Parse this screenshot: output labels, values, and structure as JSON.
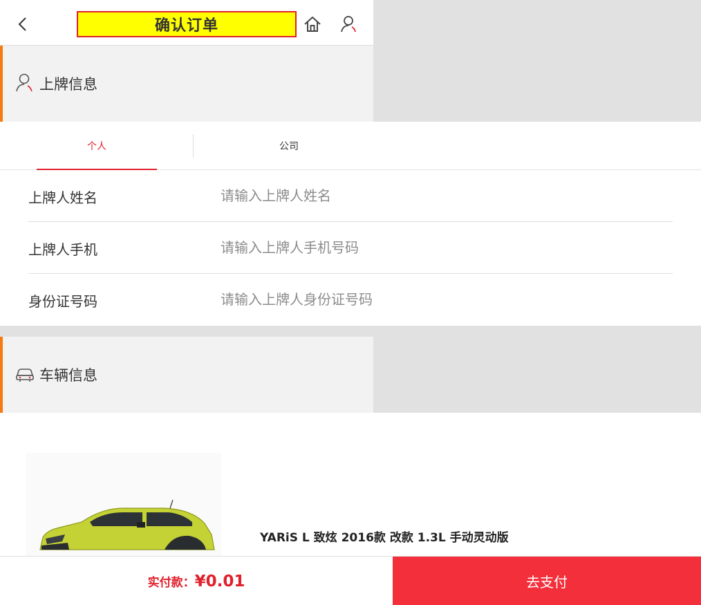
{
  "header": {
    "title": "确认订单",
    "back_icon": "chevron-left",
    "home_icon": "home",
    "user_icon": "user"
  },
  "plate_section": {
    "title": "上牌信息",
    "icon": "user-icon",
    "tabs": [
      {
        "label": "个人",
        "active": true
      },
      {
        "label": "公司",
        "active": false
      }
    ],
    "fields": [
      {
        "label": "上牌人姓名",
        "placeholder": "请输入上牌人姓名",
        "value": ""
      },
      {
        "label": "上牌人手机",
        "placeholder": "请输入上牌人手机号码",
        "value": ""
      },
      {
        "label": "身份证号码",
        "placeholder": "请输入上牌人身份证号码",
        "value": ""
      }
    ]
  },
  "vehicle_section": {
    "title": "车辆信息",
    "icon": "car-icon",
    "car_name": "YARiS L 致炫 2016款 改款 1.3L 手动灵动版"
  },
  "bottom_bar": {
    "price_label": "实付款：",
    "price_value": "¥0.01",
    "pay_button": "去支付"
  },
  "colors": {
    "accent_red": "#f22f3b",
    "title_highlight": "#ffff00",
    "section_marker": "#f57a10",
    "car_body": "#c4d235"
  }
}
